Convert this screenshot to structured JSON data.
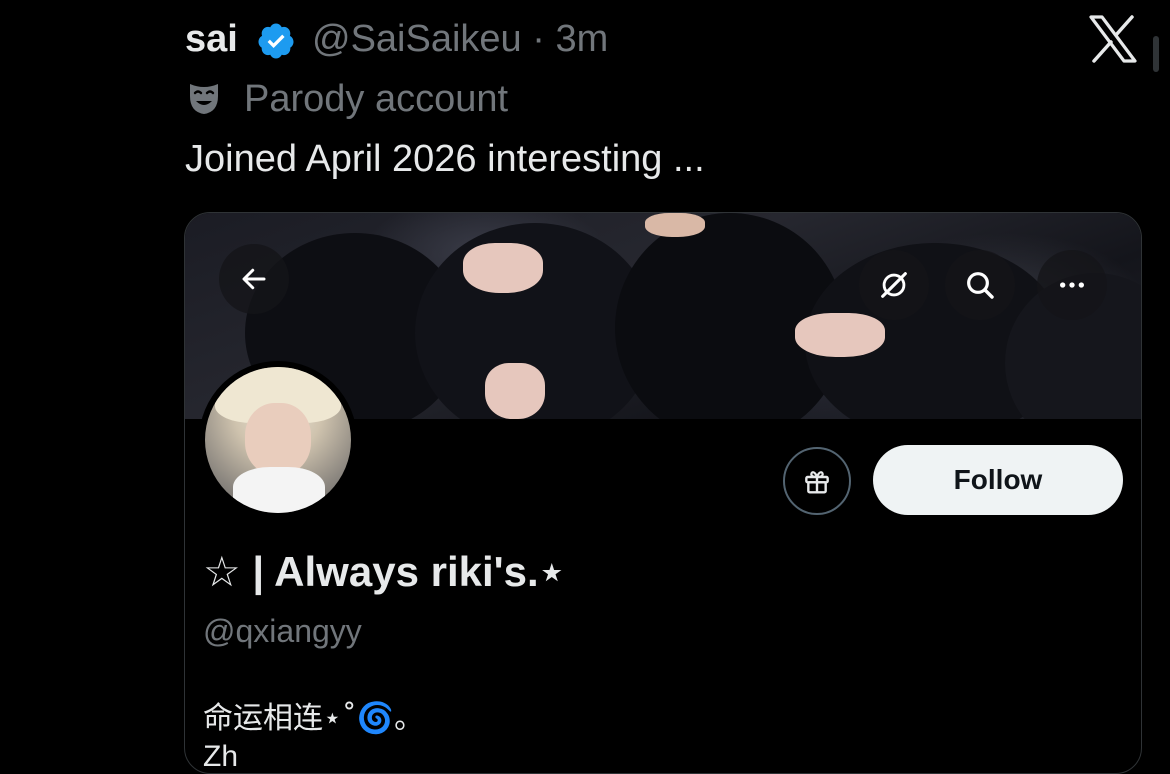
{
  "tweet": {
    "author_name": "sai",
    "verified_icon": "verified-badge-icon",
    "handle_time": "@SaiSaikeu · 3m",
    "parody_label": "Parody account",
    "text": "Joined April 2026 interesting ..."
  },
  "app": {
    "logo_icon": "x-logo-icon"
  },
  "profile": {
    "display_name": "☆ | Always riki's.⋆",
    "handle": "@qxiangyy",
    "bio": "命运相连⋆˚🌀。",
    "bio_line2": "Zh",
    "follow_label": "Follow",
    "icons": [
      "back-arrow-icon",
      "grok-icon",
      "search-icon",
      "more-icon",
      "gift-icon"
    ]
  },
  "colors": {
    "background": "#000000",
    "text_primary": "#e7e9ea",
    "text_secondary": "#71767b",
    "verified_blue": "#1d9bf0",
    "follow_bg": "#eff3f4"
  }
}
